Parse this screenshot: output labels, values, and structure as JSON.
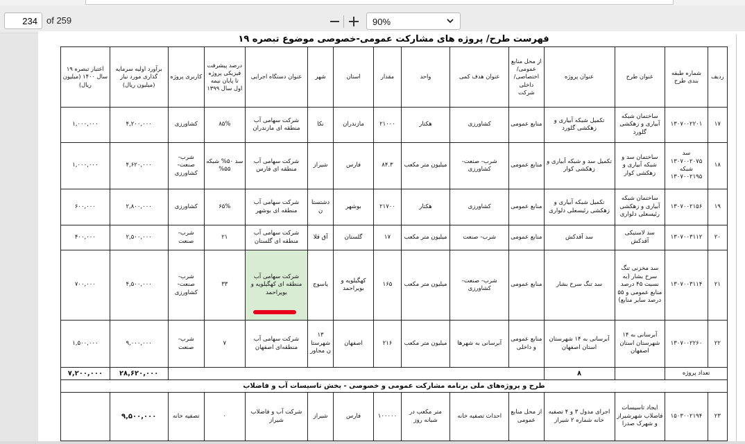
{
  "toolbar": {
    "page_number": "234",
    "page_of": "of 259",
    "zoom": "90%"
  },
  "doc": {
    "title": "فهرست طرح/ پروژه های مشارکت عمومی-خصوصی موضوع تبصره ۱۹",
    "headers": [
      "ردیف",
      "شماره طبقه بندی طرح",
      "عنوان طرح",
      "عنوان پروژه",
      "از محل منابع عمومی/ اختصاصی/ داخلی شرکت",
      "عنوان هدف کمی",
      "واحد",
      "مقدار",
      "استان",
      "شهر",
      "عنوان دستگاه اجرایی",
      "درصد پیشرفت فیزیکی پروژه تا پایان نیمه اول سال ۱۳۹۹",
      "کاربری پروژه",
      "برآورد اولیه سرمایه گذاری مورد نیاز (میلیون ریال)",
      "اعتبار تبصره ۱۹ سال ۱۴۰۰ (میلیون ریال)"
    ],
    "rows": [
      [
        "۱۷",
        "۱۳۰۷۰۰۲۲۰۱",
        "ساختمان شبکه آبیاری و زهکشی گلورد",
        "تکمیل شبکه آبیاری و زهکشی گلورد",
        "منابع عمومی",
        "کشاورزی",
        "هکتار",
        "۲۱۰۰۰",
        "مازندران",
        "نکا",
        "شرکت سهامی آب منطقه ای مازندران",
        "۸۵%",
        "کشاورزی",
        "۴,۲۰۰,۰۰۰",
        "۱,۰۰۰,۰۰۰"
      ],
      [
        "۱۸",
        "سد ۱۳۰۷۰۰۲۰۷۵ شبکه ۱۳۰۷۰۰۲۱۹۵",
        "ساختمان سد و شبکه آبیاری و زهکشی کوار",
        "تکمیل سد و شبکه آبیاری و زهکشی کوار",
        "منابع عمومی",
        "شرب- صنعت- کشاورزی",
        "میلیون متر مکعب",
        "۸۴.۳",
        "فارس",
        "شیراز",
        "شرکت سهامی آب منطقه ای فارس",
        "سد ۵۰% شبکه ۵۵%",
        "شرب- صنعت- کشاورزی",
        "۴,۶۲۰,۰۰۰",
        "۱,۰۰۰,۰۰۰"
      ],
      [
        "۱۹",
        "۱۳۰۷۰۰۲۱۵۶",
        "ساختمان شبکه آبیاری و زهکشی رئیسعلی دلواری",
        "تکمیل شبکه آبیاری و زهکشی رئیسعلی دلواری",
        "منابع عمومی",
        "کشاورزی",
        "هکتار",
        "۲۱۷۰۰",
        "بوشهر",
        "دشتستان",
        "شرکت سهامی آب منطقه ای بوشهر",
        "۶۵%",
        "کشاورزی",
        "۲,۸۰۰,۰۰۰",
        "۶۰۰,۰۰۰"
      ],
      [
        "۲۰",
        "۱۳۰۷۰۰۳۱۱۲",
        "سد لاستیکی آقدکش",
        "سد آقدکش",
        "منابع عمومی",
        "شرب- صنعت",
        "میلیون متر مکعب",
        "۱۷",
        "گلستان",
        "آق قلا",
        "شرکت سهامی آب منطقه ای گلستان",
        "۲۱",
        "شرب- صنعت",
        "۲,۵۰۰,۰۰۰",
        "۴۰۰,۰۰۰"
      ],
      [
        "۲۱",
        "۱۳۰۷۰۰۳۱۱۴",
        "سد مخزنی تنگ سرخ بشار (به نسبت ۴۵ درصد منابع عمومی و ۵۵ درصد سایر منابع)",
        "سد تنگ سرخ بشار",
        "منابع عمومی",
        "شرب- صنعت- کشاورزی",
        "میلیون متر مکعب",
        "۱۶۵",
        "کهگیلویه و بویراحمد",
        "یاسوج",
        "شرکت سهامی آب منطقه ای کهگیلویه و بویراحمد",
        "۳۳",
        "شرب- صنعت- کشاورزی",
        "۴,۵۰۰,۰۰۰",
        "۷۰۰,۰۰۰"
      ],
      [
        "۲۲",
        "۱۳۰۷۰۰۲۲۶۰",
        "آبرسانی به ۱۴ شهرستان استان اصفهان",
        "آبرسانی به ۱۴ شهرستان استان اصفهان",
        "منابع عمومی و داخلی",
        "آبرسانی به شهرها",
        "میلیون متر مکعب",
        "۲۱۶",
        "اصفهان",
        "۱۳ شهرستان مجاور",
        "شرکت سهامی آب منطقه‌ای اصفهان",
        "۷",
        "شرب- صنعت",
        "۹,۰۰۰,۰۰۰",
        "۱,۵۰۰,۰۰۰"
      ]
    ],
    "summary": {
      "label": "تعداد پروژه",
      "count": "۸",
      "total_estimate": "۲۸,۶۲۰,۰۰۰",
      "total_credit": "۷,۲۰۰,۰۰۰"
    },
    "section_title": "طرح و پروژه‌های ملی برنامه مشارکت عمومی و خصوصی - بخش تاسیسات آب و فاضلاب",
    "row23": [
      "۲۳",
      "۱۵۰۳۰۰۲۱۹۴",
      "ایجاد تاسیسات فاضلاب شهرشیراز و شهرک صدرا",
      "اجرای مدول ۳ و ۴ تصفیه خانه شماره ۲ شیراز",
      "از محل منابع عمومی",
      "احداث تصفیه خانه",
      "متر مکعب در شبانه روز",
      "۱۰۰۰۰۰",
      "فارس",
      "شیراز",
      "شرکت آب و فاضلاب شیراز",
      "۰",
      "تصفیه خانه",
      "۹,۵۰۰,۰۰۰",
      ""
    ]
  },
  "annotation": {
    "underline_color": "#e8001a"
  }
}
